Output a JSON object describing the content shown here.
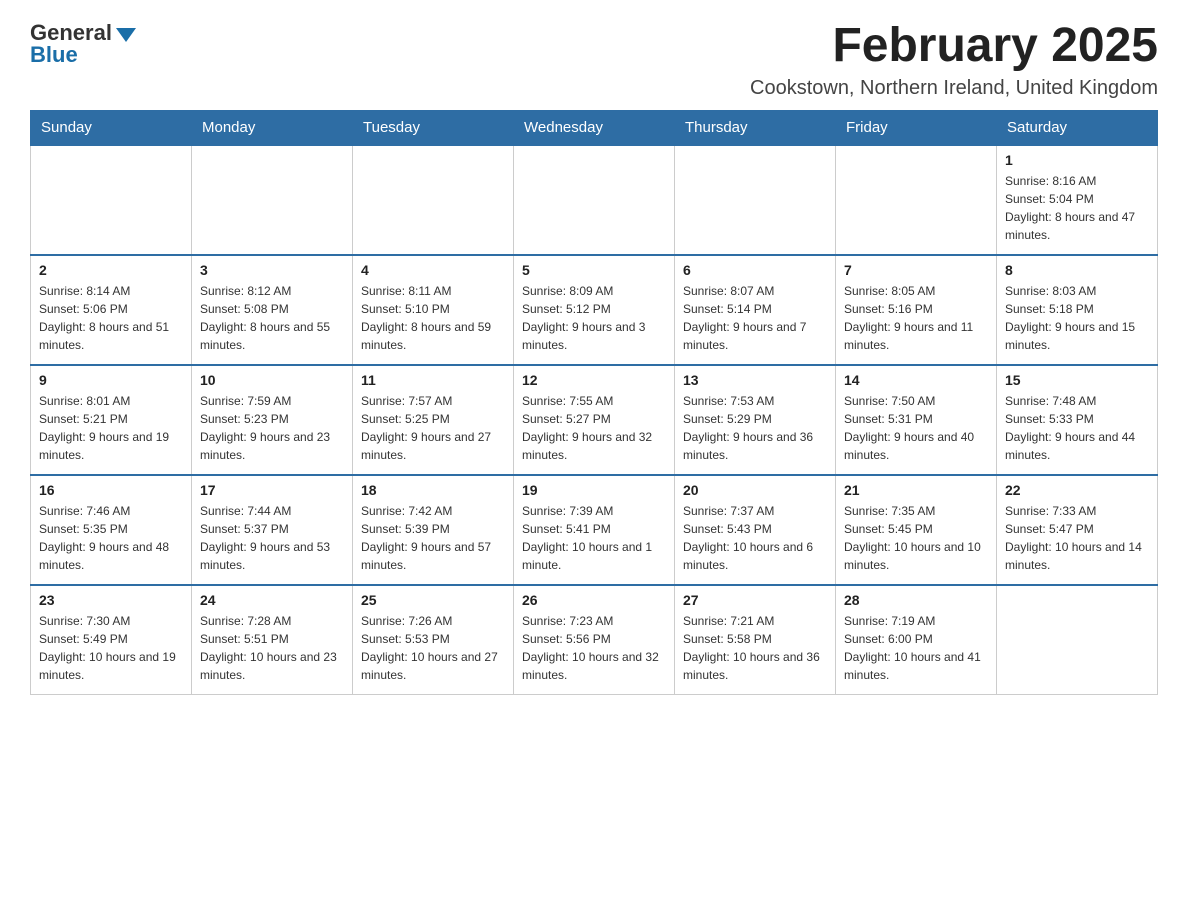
{
  "header": {
    "logo_general": "General",
    "logo_blue": "Blue",
    "month_title": "February 2025",
    "subtitle": "Cookstown, Northern Ireland, United Kingdom"
  },
  "days_of_week": [
    "Sunday",
    "Monday",
    "Tuesday",
    "Wednesday",
    "Thursday",
    "Friday",
    "Saturday"
  ],
  "weeks": [
    {
      "days": [
        {
          "number": "",
          "info": ""
        },
        {
          "number": "",
          "info": ""
        },
        {
          "number": "",
          "info": ""
        },
        {
          "number": "",
          "info": ""
        },
        {
          "number": "",
          "info": ""
        },
        {
          "number": "",
          "info": ""
        },
        {
          "number": "1",
          "info": "Sunrise: 8:16 AM\nSunset: 5:04 PM\nDaylight: 8 hours and 47 minutes."
        }
      ]
    },
    {
      "days": [
        {
          "number": "2",
          "info": "Sunrise: 8:14 AM\nSunset: 5:06 PM\nDaylight: 8 hours and 51 minutes."
        },
        {
          "number": "3",
          "info": "Sunrise: 8:12 AM\nSunset: 5:08 PM\nDaylight: 8 hours and 55 minutes."
        },
        {
          "number": "4",
          "info": "Sunrise: 8:11 AM\nSunset: 5:10 PM\nDaylight: 8 hours and 59 minutes."
        },
        {
          "number": "5",
          "info": "Sunrise: 8:09 AM\nSunset: 5:12 PM\nDaylight: 9 hours and 3 minutes."
        },
        {
          "number": "6",
          "info": "Sunrise: 8:07 AM\nSunset: 5:14 PM\nDaylight: 9 hours and 7 minutes."
        },
        {
          "number": "7",
          "info": "Sunrise: 8:05 AM\nSunset: 5:16 PM\nDaylight: 9 hours and 11 minutes."
        },
        {
          "number": "8",
          "info": "Sunrise: 8:03 AM\nSunset: 5:18 PM\nDaylight: 9 hours and 15 minutes."
        }
      ]
    },
    {
      "days": [
        {
          "number": "9",
          "info": "Sunrise: 8:01 AM\nSunset: 5:21 PM\nDaylight: 9 hours and 19 minutes."
        },
        {
          "number": "10",
          "info": "Sunrise: 7:59 AM\nSunset: 5:23 PM\nDaylight: 9 hours and 23 minutes."
        },
        {
          "number": "11",
          "info": "Sunrise: 7:57 AM\nSunset: 5:25 PM\nDaylight: 9 hours and 27 minutes."
        },
        {
          "number": "12",
          "info": "Sunrise: 7:55 AM\nSunset: 5:27 PM\nDaylight: 9 hours and 32 minutes."
        },
        {
          "number": "13",
          "info": "Sunrise: 7:53 AM\nSunset: 5:29 PM\nDaylight: 9 hours and 36 minutes."
        },
        {
          "number": "14",
          "info": "Sunrise: 7:50 AM\nSunset: 5:31 PM\nDaylight: 9 hours and 40 minutes."
        },
        {
          "number": "15",
          "info": "Sunrise: 7:48 AM\nSunset: 5:33 PM\nDaylight: 9 hours and 44 minutes."
        }
      ]
    },
    {
      "days": [
        {
          "number": "16",
          "info": "Sunrise: 7:46 AM\nSunset: 5:35 PM\nDaylight: 9 hours and 48 minutes."
        },
        {
          "number": "17",
          "info": "Sunrise: 7:44 AM\nSunset: 5:37 PM\nDaylight: 9 hours and 53 minutes."
        },
        {
          "number": "18",
          "info": "Sunrise: 7:42 AM\nSunset: 5:39 PM\nDaylight: 9 hours and 57 minutes."
        },
        {
          "number": "19",
          "info": "Sunrise: 7:39 AM\nSunset: 5:41 PM\nDaylight: 10 hours and 1 minute."
        },
        {
          "number": "20",
          "info": "Sunrise: 7:37 AM\nSunset: 5:43 PM\nDaylight: 10 hours and 6 minutes."
        },
        {
          "number": "21",
          "info": "Sunrise: 7:35 AM\nSunset: 5:45 PM\nDaylight: 10 hours and 10 minutes."
        },
        {
          "number": "22",
          "info": "Sunrise: 7:33 AM\nSunset: 5:47 PM\nDaylight: 10 hours and 14 minutes."
        }
      ]
    },
    {
      "days": [
        {
          "number": "23",
          "info": "Sunrise: 7:30 AM\nSunset: 5:49 PM\nDaylight: 10 hours and 19 minutes."
        },
        {
          "number": "24",
          "info": "Sunrise: 7:28 AM\nSunset: 5:51 PM\nDaylight: 10 hours and 23 minutes."
        },
        {
          "number": "25",
          "info": "Sunrise: 7:26 AM\nSunset: 5:53 PM\nDaylight: 10 hours and 27 minutes."
        },
        {
          "number": "26",
          "info": "Sunrise: 7:23 AM\nSunset: 5:56 PM\nDaylight: 10 hours and 32 minutes."
        },
        {
          "number": "27",
          "info": "Sunrise: 7:21 AM\nSunset: 5:58 PM\nDaylight: 10 hours and 36 minutes."
        },
        {
          "number": "28",
          "info": "Sunrise: 7:19 AM\nSunset: 6:00 PM\nDaylight: 10 hours and 41 minutes."
        },
        {
          "number": "",
          "info": ""
        }
      ]
    }
  ]
}
